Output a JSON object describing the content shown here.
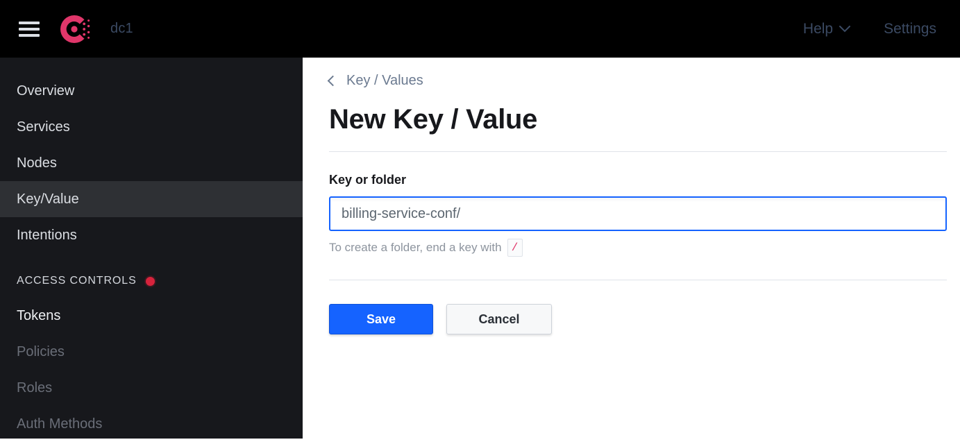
{
  "header": {
    "menu_icon": "hamburger-icon",
    "logo_icon": "consul-logo",
    "datacenter": "dc1",
    "help_label": "Help",
    "help_chevron_icon": "chevron-down-icon",
    "settings_label": "Settings",
    "background": "#000000",
    "text_color": "#3b4a63"
  },
  "sidebar": {
    "background": "#17181c",
    "active_background": "#2e3034",
    "items": [
      {
        "label": "Overview",
        "state": "normal"
      },
      {
        "label": "Services",
        "state": "normal"
      },
      {
        "label": "Nodes",
        "state": "normal"
      },
      {
        "label": "Key/Value",
        "state": "active"
      },
      {
        "label": "Intentions",
        "state": "normal"
      }
    ],
    "section": {
      "label": "ACCESS CONTROLS",
      "badge_icon": "red-dot-badge",
      "badge_color": "#d6233c"
    },
    "section_items": [
      {
        "label": "Tokens",
        "state": "bright"
      },
      {
        "label": "Policies",
        "state": "dim"
      },
      {
        "label": "Roles",
        "state": "dim"
      },
      {
        "label": "Auth Methods",
        "state": "dim"
      }
    ]
  },
  "main": {
    "breadcrumb": {
      "back_icon": "chevron-left-icon",
      "label": "Key / Values"
    },
    "title": "New Key / Value",
    "form": {
      "field_label": "Key or folder",
      "input_value": "billing-service-conf/",
      "input_placeholder": "",
      "focus_color": "#1563ff",
      "help_prefix": "To create a folder, end a key with",
      "help_code": "/",
      "help_code_color": "#e0366a"
    },
    "actions": {
      "save_label": "Save",
      "cancel_label": "Cancel",
      "save_color": "#1563ff"
    }
  }
}
